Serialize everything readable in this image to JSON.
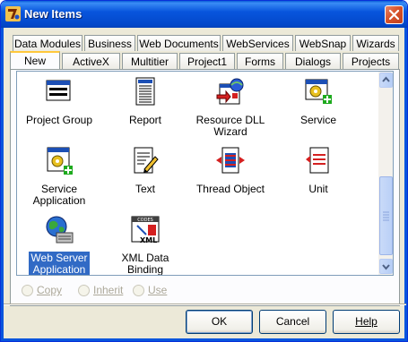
{
  "window": {
    "title": "New Items"
  },
  "tabs": {
    "row1": [
      "Data Modules",
      "Business",
      "Web Documents",
      "WebServices",
      "WebSnap",
      "Wizards"
    ],
    "row2": [
      "New",
      "ActiveX",
      "Multitier",
      "Project1",
      "Forms",
      "Dialogs",
      "Projects"
    ],
    "active": "New"
  },
  "items": [
    {
      "label": "Project Group",
      "icon": "project-group-icon"
    },
    {
      "label": "Report",
      "icon": "report-icon"
    },
    {
      "label": "Resource DLL\nWizard",
      "icon": "resource-dll-wizard-icon"
    },
    {
      "label": "Service",
      "icon": "service-icon"
    },
    {
      "label": "Service\nApplication",
      "icon": "service-application-icon"
    },
    {
      "label": "Text",
      "icon": "text-icon"
    },
    {
      "label": "Thread Object",
      "icon": "thread-object-icon"
    },
    {
      "label": "Unit",
      "icon": "unit-icon"
    },
    {
      "label": "Web Server\nApplication",
      "icon": "web-server-application-icon",
      "selected": true
    },
    {
      "label": "XML Data Binding",
      "icon": "xml-data-binding-icon"
    }
  ],
  "xml_icon_text": {
    "top": "CODES",
    "bottom": "XML"
  },
  "options": [
    "Copy",
    "Inherit",
    "Use"
  ],
  "buttons": {
    "ok": "OK",
    "cancel": "Cancel",
    "help": "Help"
  },
  "colors": {
    "selection": "#316ac5",
    "titlebar": "#0855dd"
  }
}
